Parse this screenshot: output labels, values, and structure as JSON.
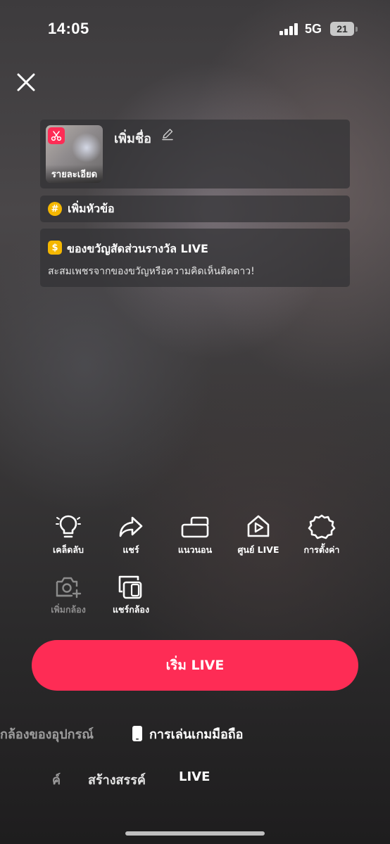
{
  "status_bar": {
    "time": "14:05",
    "network": "5G",
    "battery": "21"
  },
  "title_card": {
    "thumb_label": "รายละเอียด",
    "add_title": "เพิ่มชื่อ"
  },
  "topic_card": {
    "label": "เพิ่มหัวข้อ"
  },
  "gift_card": {
    "title": "ของขวัญสัดส่วนรางวัล LIVE",
    "subtitle": "สะสมเพชรจากของขวัญหรือความคิดเห็นติดดาว!"
  },
  "tools": {
    "tips": "เคล็ดลับ",
    "share": "แชร์",
    "landscape": "แนวนอน",
    "live_center": "ศูนย์ LIVE",
    "settings": "การตั้งค่า",
    "add_camera": "เพิ่มกล้อง",
    "share_camera": "แชร์กล้อง"
  },
  "start_button": "เริ่ม LIVE",
  "modes": {
    "device_camera": "กล้องของอุปกรณ์",
    "mobile_gaming": "การเล่นเกมมือถือ"
  },
  "bottom_tabs": {
    "faded": "ค์",
    "create": "สร้างสรรค์",
    "live": "LIVE"
  },
  "colors": {
    "accent": "#fe2c55",
    "coin": "#f5b700"
  }
}
